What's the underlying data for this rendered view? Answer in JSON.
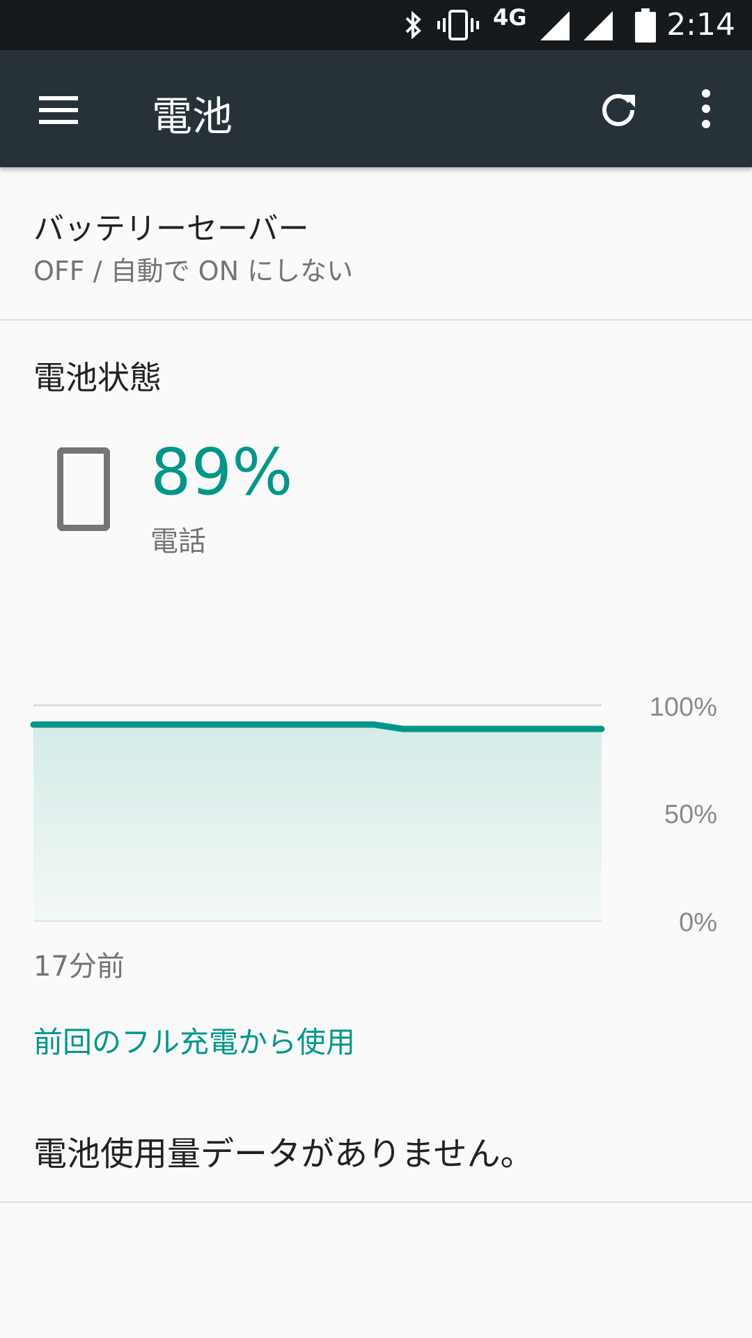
{
  "status_bar": {
    "network": "4G",
    "time": "2:14",
    "icons": [
      "bluetooth-icon",
      "vibrate-icon",
      "signal-icon",
      "signal-icon",
      "battery-icon"
    ]
  },
  "toolbar": {
    "title": "電池",
    "icons": [
      "menu-icon",
      "refresh-icon",
      "more-vert-icon"
    ]
  },
  "battery_saver": {
    "title": "バッテリーセーバー",
    "subtitle": "OFF / 自動で ON にしない"
  },
  "battery_status": {
    "section_title": "電池状態",
    "percent": "89%",
    "device_label": "電話"
  },
  "chart_data": {
    "type": "area",
    "x_label_start": "17分前",
    "y_tick_labels": [
      "100%",
      "50%",
      "0%"
    ],
    "ylim": [
      0,
      100
    ],
    "x": [
      0,
      0.6,
      0.65,
      1
    ],
    "values": [
      91,
      91,
      89,
      89
    ],
    "color": "#009688"
  },
  "usage": {
    "link_label": "前回のフル充電から使用",
    "no_data_text": "電池使用量データがありません。"
  },
  "colors": {
    "accent": "#009688",
    "toolbar": "#263238",
    "statusbar": "#15191c"
  }
}
